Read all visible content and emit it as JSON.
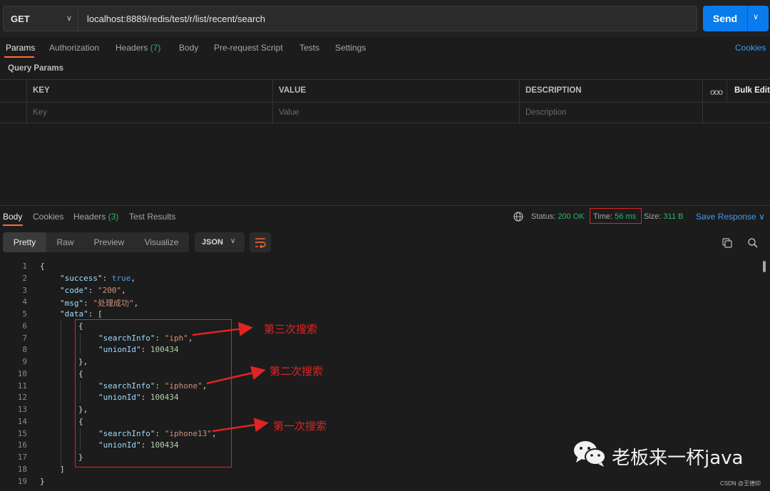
{
  "request": {
    "method": "GET",
    "url": "localhost:8889/redis/test/r/list/recent/search",
    "send_label": "Send"
  },
  "request_tabs": [
    {
      "label": "Params"
    },
    {
      "label": "Authorization"
    },
    {
      "label": "Headers",
      "count": "(7)"
    },
    {
      "label": "Body"
    },
    {
      "label": "Pre-request Script"
    },
    {
      "label": "Tests"
    },
    {
      "label": "Settings"
    }
  ],
  "cookies_link": "Cookies",
  "query_params": {
    "title": "Query Params",
    "headers": [
      "KEY",
      "VALUE",
      "DESCRIPTION"
    ],
    "bulk_edit": "Bulk Edit",
    "more": "ooo",
    "placeholders": {
      "key": "Key",
      "value": "Value",
      "description": "Description"
    }
  },
  "response_tabs": [
    {
      "label": "Body"
    },
    {
      "label": "Cookies"
    },
    {
      "label": "Headers",
      "count": "(3)"
    },
    {
      "label": "Test Results"
    }
  ],
  "response_status": {
    "status_label": "Status:",
    "status_value": "200 OK",
    "time_label": "Time:",
    "time_value": "56 ms",
    "size_label": "Size:",
    "size_value": "311 B",
    "save_label": "Save Response"
  },
  "view_tabs": [
    "Pretty",
    "Raw",
    "Preview",
    "Visualize"
  ],
  "format": "JSON",
  "code": {
    "line_numbers": [
      "1",
      "2",
      "3",
      "4",
      "5",
      "6",
      "7",
      "8",
      "9",
      "10",
      "11",
      "12",
      "13",
      "14",
      "15",
      "16",
      "17",
      "18",
      "19"
    ],
    "success_key": "\"success\"",
    "success_val": "true",
    "code_key": "\"code\"",
    "code_val": "\"200\"",
    "msg_key": "\"msg\"",
    "msg_val": "\"处理成功\"",
    "data_key": "\"data\"",
    "search_key": "\"searchInfo\"",
    "union_key": "\"unionId\"",
    "items": [
      {
        "searchInfo": "\"iph\"",
        "unionId": "100434"
      },
      {
        "searchInfo": "\"iphone\"",
        "unionId": "100434"
      },
      {
        "searchInfo": "\"iphone13\"",
        "unionId": "100434"
      }
    ]
  },
  "annotations": [
    "第三次搜索",
    "第二次搜索",
    "第一次搜索"
  ],
  "watermark": {
    "text": "老板来一杯java",
    "credit": "CSDN @王德印"
  },
  "colors": {
    "send": "#097bed",
    "accent": "#ff6c37",
    "link": "#3d9cf2",
    "ok": "#2fb56d",
    "annotation": "#e02424"
  }
}
